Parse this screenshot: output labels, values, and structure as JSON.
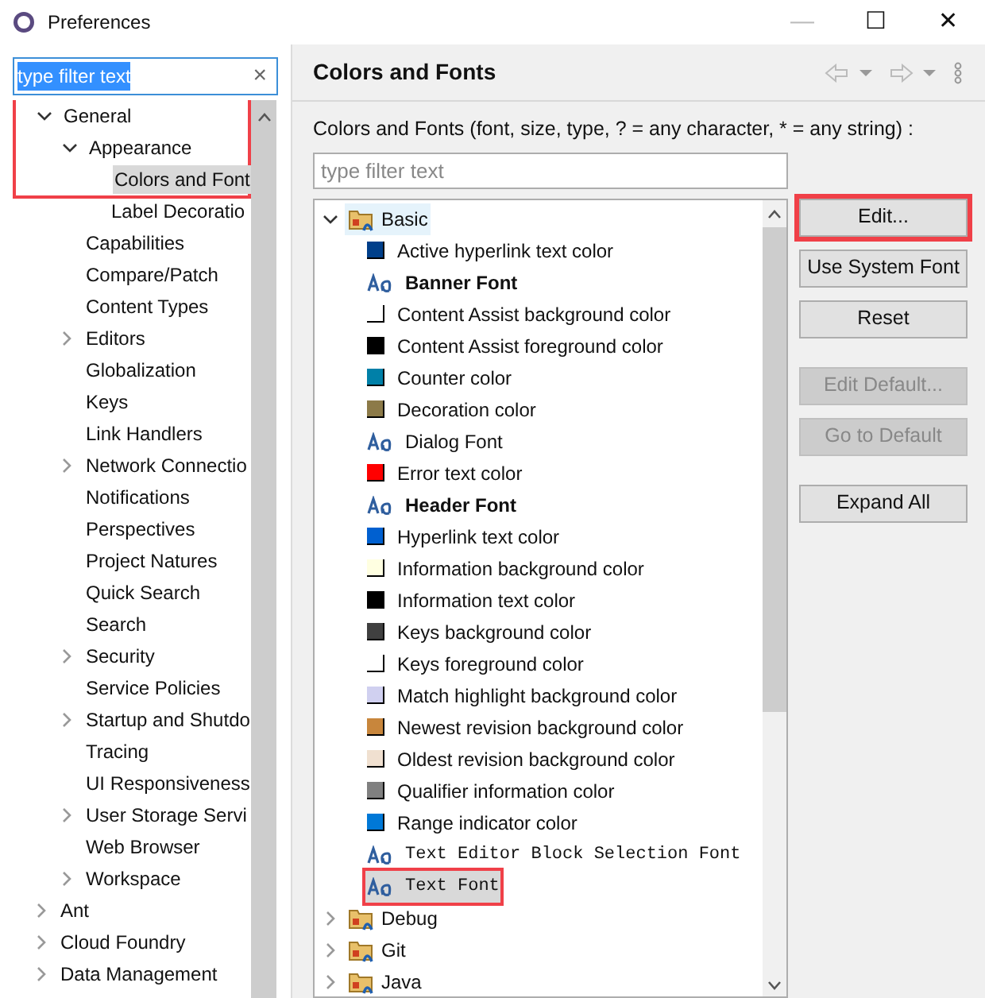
{
  "window": {
    "title": "Preferences",
    "controls": [
      "—",
      "☐",
      "✕"
    ]
  },
  "left": {
    "filter": {
      "value": "type filter text"
    },
    "clear": "×",
    "tree": [
      {
        "label": "General",
        "expanded": true,
        "highlighted": true,
        "selected": false,
        "children": [
          {
            "label": "Appearance",
            "expanded": true,
            "selected": false,
            "children": [
              {
                "label": "Colors and Font",
                "selected": true
              },
              {
                "label": "Label Decoratio",
                "selected": false
              }
            ]
          },
          {
            "label": "Capabilities",
            "selected": false
          },
          {
            "label": "Compare/Patch",
            "selected": false
          },
          {
            "label": "Content Types",
            "selected": false
          },
          {
            "label": "Editors",
            "expanded": false,
            "selected": false,
            "children_hidden": true
          },
          {
            "label": "Globalization",
            "selected": false
          },
          {
            "label": "Keys",
            "selected": false
          },
          {
            "label": "Link Handlers",
            "selected": false
          },
          {
            "label": "Network Connectio",
            "expanded": false,
            "selected": false,
            "children_hidden": true
          },
          {
            "label": "Notifications",
            "selected": false
          },
          {
            "label": "Perspectives",
            "selected": false
          },
          {
            "label": "Project Natures",
            "selected": false
          },
          {
            "label": "Quick Search",
            "selected": false
          },
          {
            "label": "Search",
            "selected": false
          },
          {
            "label": "Security",
            "expanded": false,
            "selected": false,
            "children_hidden": true
          },
          {
            "label": "Service Policies",
            "selected": false
          },
          {
            "label": "Startup and Shutdo",
            "expanded": false,
            "selected": false,
            "children_hidden": true
          },
          {
            "label": "Tracing",
            "selected": false
          },
          {
            "label": "UI Responsiveness",
            "selected": false
          },
          {
            "label": "User Storage Servi",
            "expanded": false,
            "selected": false,
            "children_hidden": true
          },
          {
            "label": "Web Browser",
            "selected": false
          },
          {
            "label": "Workspace",
            "expanded": false,
            "selected": false,
            "children_hidden": true
          }
        ]
      },
      {
        "label": "Ant",
        "expanded": false,
        "selected": false,
        "children_hidden": true
      },
      {
        "label": "Cloud Foundry",
        "expanded": false,
        "selected": false,
        "children_hidden": true
      },
      {
        "label": "Data Management",
        "expanded": false,
        "selected": false,
        "children_hidden": true
      }
    ]
  },
  "right": {
    "title": "Colors and Fonts",
    "description": "Colors and Fonts (font, size, type, ? = any character, * = any string) :",
    "filter": {
      "placeholder": "type filter text"
    },
    "tree": [
      {
        "label": "Basic",
        "expanded": true,
        "selected": false,
        "children": [
          {
            "kind": "color",
            "label": "Active hyperlink text color",
            "color": "#003f8a",
            "selected": false
          },
          {
            "kind": "bold_font",
            "label": "Banner Font",
            "selected": false
          },
          {
            "kind": "color",
            "label": "Content Assist background color",
            "color": "#ffffff",
            "selected": false
          },
          {
            "kind": "color",
            "label": "Content Assist foreground color",
            "color": "#000000",
            "selected": false
          },
          {
            "kind": "color",
            "label": "Counter color",
            "color": "#0080a8",
            "selected": false
          },
          {
            "kind": "color",
            "label": "Decoration color",
            "color": "#8c7a48",
            "selected": false
          },
          {
            "kind": "font",
            "label": "Dialog Font",
            "selected": false
          },
          {
            "kind": "color",
            "label": "Error text color",
            "color": "#ff0000",
            "selected": false
          },
          {
            "kind": "bold_font",
            "label": "Header Font",
            "selected": false
          },
          {
            "kind": "color",
            "label": "Hyperlink text color",
            "color": "#0060d0",
            "selected": false
          },
          {
            "kind": "color",
            "label": "Information background color",
            "color": "#ffffe1",
            "selected": false
          },
          {
            "kind": "color",
            "label": "Information text color",
            "color": "#000000",
            "selected": false
          },
          {
            "kind": "color",
            "label": "Keys background color",
            "color": "#404040",
            "selected": false
          },
          {
            "kind": "color",
            "label": "Keys foreground color",
            "color": "#ffffff",
            "selected": false
          },
          {
            "kind": "color",
            "label": "Match highlight background color",
            "color": "#d0d0f0",
            "selected": false
          },
          {
            "kind": "color",
            "label": "Newest revision background color",
            "color": "#c8863c",
            "selected": false
          },
          {
            "kind": "color",
            "label": "Oldest revision background color",
            "color": "#f0e0d0",
            "selected": false
          },
          {
            "kind": "color",
            "label": "Qualifier information color",
            "color": "#808080",
            "selected": false
          },
          {
            "kind": "color",
            "label": "Range indicator color",
            "color": "#0078d7",
            "selected": false
          },
          {
            "kind": "mono_font",
            "label": "Text Editor Block Selection Font",
            "selected": false
          },
          {
            "kind": "mono_font",
            "label": "Text Font",
            "selected": true,
            "highlighted": true
          }
        ]
      },
      {
        "label": "Debug",
        "expanded": false,
        "selected": false
      },
      {
        "label": "Git",
        "expanded": false,
        "selected": false
      },
      {
        "label": "Java",
        "expanded": false,
        "selected": false
      }
    ],
    "buttons": [
      {
        "label": "Edit...",
        "disabled": false,
        "highlighted": true
      },
      {
        "label": "Use System Font",
        "disabled": false,
        "highlighted": false
      },
      {
        "label": "Reset",
        "disabled": false,
        "highlighted": false
      },
      {
        "label": "Edit Default...",
        "disabled": true,
        "highlighted": false
      },
      {
        "label": "Go to Default",
        "disabled": true,
        "highlighted": false
      },
      {
        "label": "Expand All",
        "disabled": false,
        "highlighted": false
      }
    ]
  }
}
